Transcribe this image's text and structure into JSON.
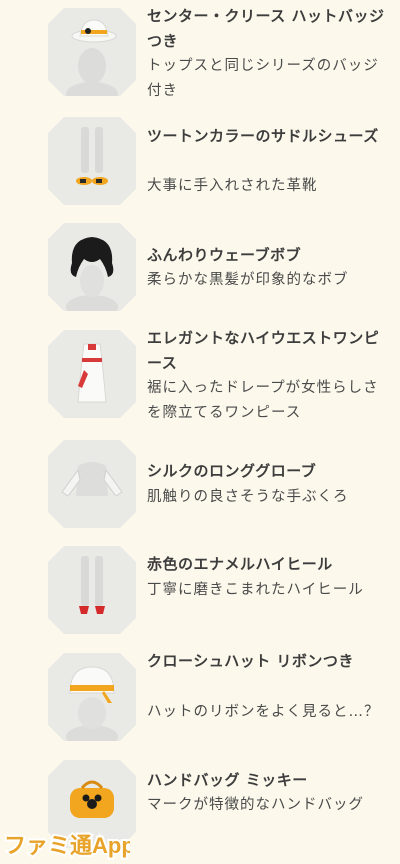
{
  "items": [
    {
      "name": "センター・クリース ハットバッジつき",
      "desc": "トップスと同じシリーズのバッジ付き"
    },
    {
      "name": "ツートンカラーのサドルシューズ",
      "desc": "大事に手入れされた革靴"
    },
    {
      "name": "ふんわりウェーブボブ",
      "desc": "柔らかな黒髪が印象的なボブ"
    },
    {
      "name": "エレガントなハイウエストワンピース",
      "desc": "裾に入ったドレープが女性らしさを際立てるワンピース"
    },
    {
      "name": "シルクのロンググローブ",
      "desc": "肌触りの良さそうな手ぶくろ"
    },
    {
      "name": "赤色のエナメルハイヒール",
      "desc": "丁寧に磨きこまれたハイヒール"
    },
    {
      "name": "クローシュハット リボンつき",
      "desc": "ハットのリボンをよく見ると…？"
    },
    {
      "name": "ハンドバッグ ミッキー",
      "desc": "マークが特徴的なハンドバッグ"
    }
  ],
  "watermark": {
    "text": "ファミ通App"
  },
  "colors": {
    "background": "#fcf9ec",
    "thumb": "#e9e9e6",
    "accent": "#f2a51e"
  }
}
